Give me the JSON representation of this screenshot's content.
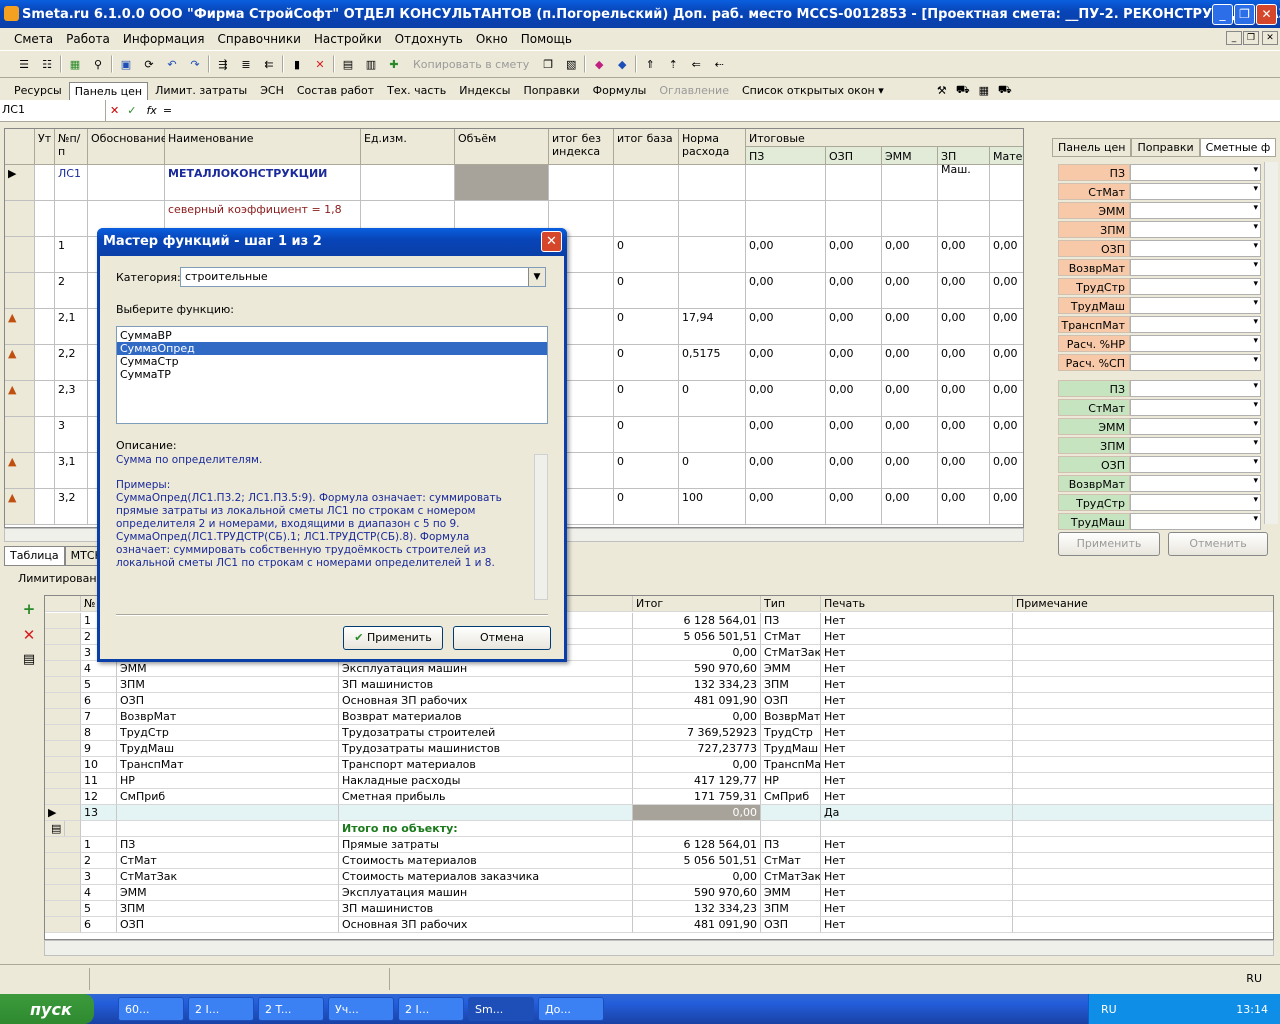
{
  "window": {
    "title": "Smeta.ru  6.1.0.0  ООО \"Фирма СтройСофт\" ОТДЕЛ КОНСУЛЬТАНТОВ (п.Погорельский)  Доп. раб. место  MCCS-0012853 - [Проектная смета: __ПУ-2. РЕКОНСТРУКЦИЯ ГАЗОХОД]"
  },
  "menu": [
    "Смета",
    "Работа",
    "Информация",
    "Справочники",
    "Настройки",
    "Отдохнуть",
    "Окно",
    "Помощь"
  ],
  "toolbar": {
    "copy_label": "Копировать в смету"
  },
  "tabs": [
    {
      "label": "Ресурсы"
    },
    {
      "label": "Панель цен",
      "active": true
    },
    {
      "label": "Лимит. затраты"
    },
    {
      "label": "ЭСН"
    },
    {
      "label": "Состав работ"
    },
    {
      "label": "Тех. часть"
    },
    {
      "label": "Индексы"
    },
    {
      "label": "Поправки"
    },
    {
      "label": "Формулы"
    },
    {
      "label": "Оглавление",
      "disabled": true
    },
    {
      "label": "Список открытых окон ▾"
    }
  ],
  "formula": {
    "cell": "ЛС1",
    "value": "="
  },
  "grid": {
    "headers": [
      "Ут",
      "№п/п",
      "Обоснование",
      "Наименование",
      "Ед.изм.",
      "Объём",
      "итог без индекса",
      "итог база",
      "Норма расхода",
      "Итоговые"
    ],
    "subheaders": [
      "ПЗ",
      "ОЗП",
      "ЭММ",
      "ЗП Маш.",
      "Матер"
    ],
    "rows": [
      {
        "num": "ЛС1",
        "name": "МЕТАЛЛОКОНСТРУКЦИИ",
        "kind": "header"
      },
      {
        "num": "",
        "name": "северный коэффициент = 1,8",
        "kind": "note"
      },
      {
        "num": "1",
        "base": "0",
        "norm": "",
        "vals": [
          "0,00",
          "0,00",
          "0,00",
          "0,00",
          "0,00"
        ]
      },
      {
        "num": "2",
        "base": "0",
        "norm": "",
        "vals": [
          "0,00",
          "0,00",
          "0,00",
          "0,00",
          "0,00"
        ]
      },
      {
        "num": "2,1",
        "base": "0",
        "norm": "17,94",
        "vals": [
          "0,00",
          "0,00",
          "0,00",
          "0,00",
          "0,00"
        ]
      },
      {
        "num": "2,2",
        "base": "0",
        "norm": "0,5175",
        "vals": [
          "0,00",
          "0,00",
          "0,00",
          "0,00",
          "0,00"
        ]
      },
      {
        "num": "2,3",
        "base": "0",
        "norm": "0",
        "vals": [
          "0,00",
          "0,00",
          "0,00",
          "0,00",
          "0,00"
        ]
      },
      {
        "num": "3",
        "base": "0",
        "norm": "",
        "vals": [
          "0,00",
          "0,00",
          "0,00",
          "0,00",
          "0,00"
        ]
      },
      {
        "num": "3,1",
        "base": "0",
        "norm": "0",
        "vals": [
          "0,00",
          "0,00",
          "0,00",
          "0,00",
          "0,00"
        ]
      },
      {
        "num": "3,2",
        "base": "0",
        "norm": "100",
        "vals": [
          "0,00",
          "0,00",
          "0,00",
          "0,00",
          "0,00"
        ]
      }
    ],
    "bottom_tabs": [
      "Таблица",
      "МТСН"
    ]
  },
  "right_panel": {
    "tabs": [
      "Панель цен",
      "Поправки",
      "Сметные ф"
    ],
    "group1": [
      "ПЗ",
      "СтМат",
      "ЭММ",
      "ЗПМ",
      "ОЗП",
      "ВозврМат",
      "ТрудСтр",
      "ТрудМаш",
      "ТранспМат",
      "Расч. %НР",
      "Расч. %СП"
    ],
    "group2": [
      "ПЗ",
      "СтМат",
      "ЭММ",
      "ЗПМ",
      "ОЗП",
      "ВозврМат",
      "ТрудСтр",
      "ТрудМаш"
    ],
    "apply": "Применить",
    "cancel": "Отменить"
  },
  "bottom": {
    "section_tab": "Лимитированн",
    "headers": [
      "№",
      "",
      "",
      "Итог",
      "Тип",
      "Печать",
      "Примечание"
    ],
    "rows": [
      {
        "n": "1",
        "code": "",
        "name": "",
        "total": "6 128 564,01",
        "type": "ПЗ",
        "print": "Нет"
      },
      {
        "n": "2",
        "code": "",
        "name": "",
        "total": "5 056 501,51",
        "type": "СтМат",
        "print": "Нет"
      },
      {
        "n": "3",
        "code": "",
        "name": "",
        "total": "0,00",
        "type": "СтМатЗак",
        "print": "Нет"
      },
      {
        "n": "4",
        "code": "ЭММ",
        "name": "Эксплуатация машин",
        "total": "590 970,60",
        "type": "ЭММ",
        "print": "Нет"
      },
      {
        "n": "5",
        "code": "ЗПМ",
        "name": "ЗП машинистов",
        "total": "132 334,23",
        "type": "ЗПМ",
        "print": "Нет"
      },
      {
        "n": "6",
        "code": "ОЗП",
        "name": "Основная ЗП рабочих",
        "total": "481 091,90",
        "type": "ОЗП",
        "print": "Нет"
      },
      {
        "n": "7",
        "code": "ВозврМат",
        "name": "Возврат материалов",
        "total": "0,00",
        "type": "ВозврМат",
        "print": "Нет"
      },
      {
        "n": "8",
        "code": "ТрудСтр",
        "name": "Трудозатраты строителей",
        "total": "7 369,52923",
        "type": "ТрудСтр",
        "print": "Нет"
      },
      {
        "n": "9",
        "code": "ТрудМаш",
        "name": "Трудозатраты машинистов",
        "total": "727,23773",
        "type": "ТрудМаш",
        "print": "Нет"
      },
      {
        "n": "10",
        "code": "ТранспМат",
        "name": "Транспорт материалов",
        "total": "0,00",
        "type": "ТранспМат",
        "print": "Нет"
      },
      {
        "n": "11",
        "code": "НР",
        "name": "Накладные расходы",
        "total": "417 129,77",
        "type": "НР",
        "print": "Нет"
      },
      {
        "n": "12",
        "code": "СмПриб",
        "name": "Сметная прибыль",
        "total": "171 759,31",
        "type": "СмПриб",
        "print": "Нет"
      },
      {
        "n": "13",
        "code": "",
        "name": "",
        "total": "0,00",
        "type": "",
        "print": "Да",
        "selected": true
      },
      {
        "n": "",
        "code": "",
        "name": "Итого по объекту:",
        "total": "",
        "type": "",
        "print": "",
        "group": true
      },
      {
        "n": "1",
        "code": "ПЗ",
        "name": "Прямые затраты",
        "total": "6 128 564,01",
        "type": "ПЗ",
        "print": "Нет"
      },
      {
        "n": "2",
        "code": "СтМат",
        "name": "Стоимость материалов",
        "total": "5 056 501,51",
        "type": "СтМат",
        "print": "Нет"
      },
      {
        "n": "3",
        "code": "СтМатЗак",
        "name": "Стоимость материалов заказчика",
        "total": "0,00",
        "type": "СтМатЗак",
        "print": "Нет"
      },
      {
        "n": "4",
        "code": "ЭММ",
        "name": "Эксплуатация машин",
        "total": "590 970,60",
        "type": "ЭММ",
        "print": "Нет"
      },
      {
        "n": "5",
        "code": "ЗПМ",
        "name": "ЗП машинистов",
        "total": "132 334,23",
        "type": "ЗПМ",
        "print": "Нет"
      },
      {
        "n": "6",
        "code": "ОЗП",
        "name": "Основная ЗП рабочих",
        "total": "481 091,90",
        "type": "ОЗП",
        "print": "Нет"
      }
    ]
  },
  "dialog": {
    "title": "Мастер функций - шаг 1 из 2",
    "category_label": "Категория:",
    "category_value": "строительные",
    "choose_label": "Выберите функцию:",
    "functions": [
      "СуммаВР",
      "СуммаОпред",
      "СуммаСтр",
      "СуммаТР"
    ],
    "selected_index": 1,
    "desc_label": "Описание:",
    "desc_text": "Сумма по определителям.",
    "examples_label": "Примеры:",
    "example1": "СуммаОпред(ЛС1.П3.2; ЛС1.П3.5:9). Формула означает: суммировать прямые затраты из локальной сметы ЛС1 по строкам с номером определителя 2 и номерами, входящими в диапазон с 5 по 9.",
    "example2": "СуммаОпред(ЛС1.ТРУДСТР(СБ).1; ЛС1.ТРУДСТР(СБ).8). Формула означает: суммировать собственную трудоёмкость строителей из локальной сметы ЛС1 по строкам с номерами определителей 1 и 8.",
    "ok": "Применить",
    "cancel": "Отмена"
  },
  "status": {
    "lang": "RU"
  },
  "taskbar": {
    "start": "пуск",
    "buttons": [
      "60...",
      "2 I...",
      "2 T...",
      "Уч...",
      "2 I...",
      "Sm...",
      "До..."
    ],
    "active_index": 5,
    "tray_lang": "RU",
    "clock": "13:14"
  }
}
